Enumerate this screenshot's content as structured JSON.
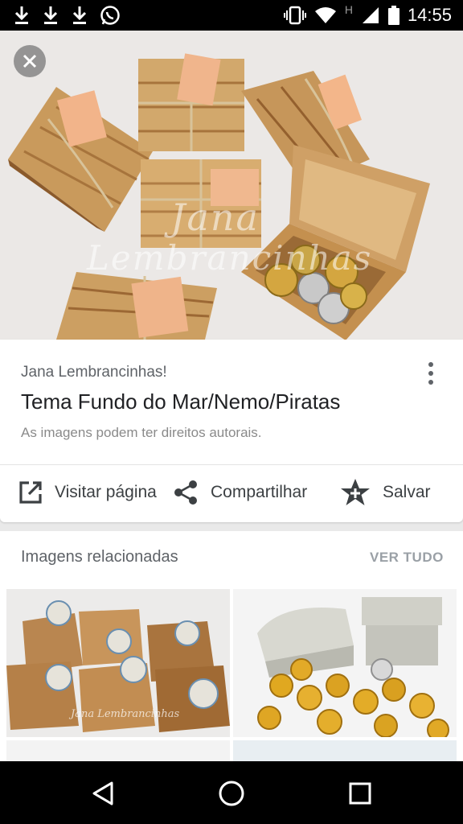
{
  "status_bar": {
    "time": "14:55",
    "network_label": "H",
    "icons": [
      "download-icon",
      "download-icon",
      "download-icon",
      "whatsapp-icon",
      "vibrate-icon",
      "wifi-icon",
      "signal-icon",
      "battery-icon"
    ]
  },
  "hero": {
    "watermark_line1": "Jana",
    "watermark_line2": "Lembrancinhas",
    "colors": {
      "wood_light": "#d9b27a",
      "wood_dark": "#8b5a2b",
      "coin_gold": "#d4a640",
      "coin_silver": "#c8c8c8"
    }
  },
  "info": {
    "source": "Jana Lembrancinhas!",
    "title": "Tema Fundo do Mar/Nemo/Piratas",
    "copyright": "As imagens podem ter direitos autorais."
  },
  "actions": {
    "visit_label": "Visitar página",
    "share_label": "Compartilhar",
    "save_label": "Salvar"
  },
  "related": {
    "title": "Imagens relacionadas",
    "see_all": "VER TUDO",
    "thumb1_watermark": "Jana Lembrancinhas"
  },
  "nav": {
    "icons": [
      "back-icon",
      "home-icon",
      "recents-icon"
    ]
  }
}
